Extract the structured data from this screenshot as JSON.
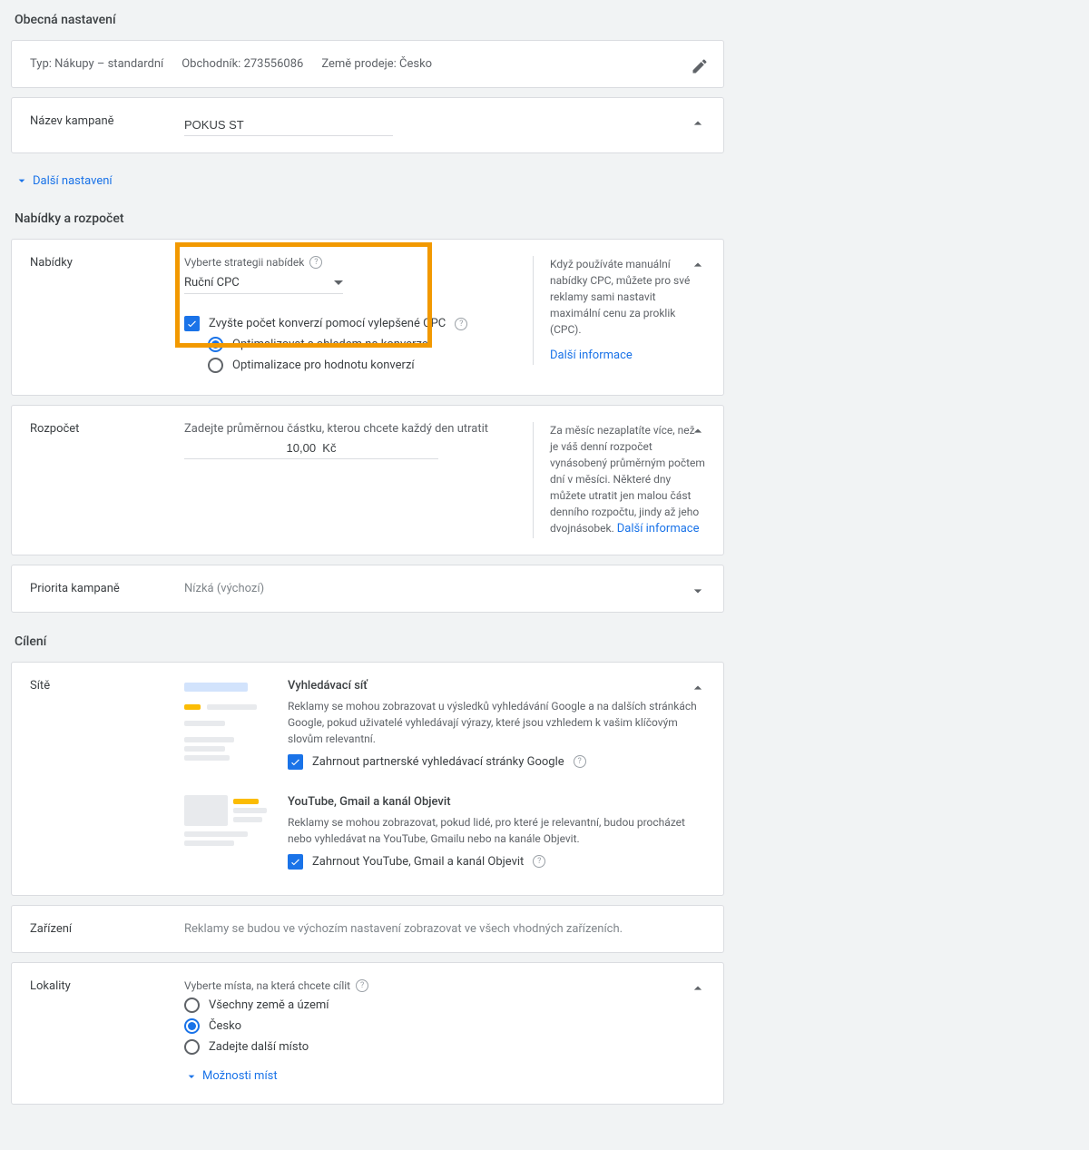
{
  "sections": {
    "general": "Obecná nastavení",
    "bids_budget": "Nabídky a rozpočet",
    "targeting": "Cílení"
  },
  "summary": {
    "type_label": "Typ:",
    "type_value": "Nákupy – standardní",
    "merchant_label": "Obchodník:",
    "merchant_value": "273556086",
    "country_label": "Země prodeje:",
    "country_value": "Česko"
  },
  "campaign": {
    "label": "Název kampaně",
    "value": "POKUS ST"
  },
  "more_settings": "Další nastavení",
  "bids": {
    "label": "Nabídky",
    "strategy_label": "Vyberte strategii nabídek",
    "strategy_value": "Ruční CPC",
    "enhanced_cpc": "Zvyšte počet konverzí pomocí vylepšené CPC",
    "opt_conversions": "Optimalizovat s ohledem na konverze",
    "opt_value": "Optimalizace pro hodnotu konverzí",
    "help_text": "Když používáte manuální nabídky CPC, můžete pro své reklamy sami nastavit maximální cenu za proklik (CPC).",
    "help_link": "Další informace"
  },
  "budget": {
    "label": "Rozpočet",
    "prompt": "Zadejte průměrnou částku, kterou chcete každý den utratit",
    "value": "10,00  Kč",
    "help_text": "Za měsíc nezaplatíte více, než je váš denní rozpočet vynásobený průměrným počtem dní v měsíci. Některé dny můžete utratit jen malou část denního rozpočtu, jindy až jeho dvojnásobek. ",
    "help_link": "Další informace"
  },
  "priority": {
    "label": "Priorita kampaně",
    "value": "Nízká (výchozí)"
  },
  "networks": {
    "label": "Sítě",
    "search": {
      "title": "Vyhledávací síť",
      "desc": "Reklamy se mohou zobrazovat u výsledků vyhledávání Google a na dalších stránkách Google, pokud uživatelé vyhledávají výrazy, které jsou vzhledem k vašim klíčovým slovům relevantní.",
      "cb": "Zahrnout partnerské vyhledávací stránky Google"
    },
    "yt": {
      "title": "YouTube, Gmail a kanál Objevit",
      "desc": "Reklamy se mohou zobrazovat, pokud lidé, pro které je relevantní, budou procházet nebo vyhledávat na YouTube, Gmailu nebo na kanále Objevit.",
      "cb": "Zahrnout YouTube, Gmail a kanál Objevit"
    }
  },
  "devices": {
    "label": "Zařízení",
    "value": "Reklamy se budou ve výchozím nastavení zobrazovat ve všech vhodných zařízeních."
  },
  "locations": {
    "label": "Lokality",
    "prompt": "Vyberte místa, na která chcete cílit",
    "opt_all": "Všechny země a území",
    "opt_cz": "Česko",
    "opt_other": "Zadejte další místo",
    "options_link": "Možnosti míst"
  }
}
